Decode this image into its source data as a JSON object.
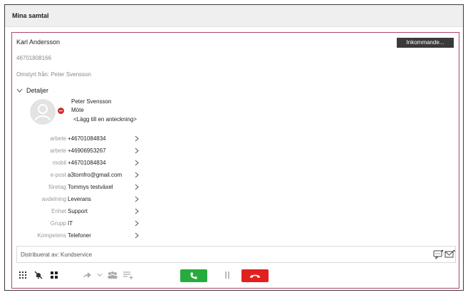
{
  "window": {
    "title": "Mina samtal"
  },
  "call": {
    "caller_name": "Karl Andersson",
    "caller_number": "46701808166",
    "redirected_from": "Omstyrt från: Peter Svensson",
    "incoming_label": "Inkommande...",
    "details_label": "Detaljer"
  },
  "contact": {
    "name": "Peter Svensson",
    "status": "Möte",
    "status_color": "#d32a2a",
    "add_note": "<Lägg till en anteckning>",
    "fields": [
      {
        "label": "arbete",
        "value": "+46701084834"
      },
      {
        "label": "arbete",
        "value": "+46906953267"
      },
      {
        "label": "mobil",
        "value": "+46701084834"
      },
      {
        "label": "e-post",
        "value": "a3tomfro@gmail.com"
      },
      {
        "label": "företag",
        "value": "Tommys testväxel"
      },
      {
        "label": "avdelning",
        "value": "Leverans"
      },
      {
        "label": "Enhet",
        "value": "Support"
      },
      {
        "label": "Grupp",
        "value": "IT"
      },
      {
        "label": "Kompetens",
        "value": "Telefoner"
      }
    ]
  },
  "distribution": {
    "text": "Distribuerat av: Kundservice"
  },
  "toolbar": {
    "answer_color": "#27ab3f",
    "hangup_color": "#e22020",
    "icons": [
      "dialpad-icon",
      "mute-icon",
      "grid-icon",
      "transfer-icon",
      "dropdown-icon",
      "conference-icon",
      "queue-icon",
      "answer-icon",
      "hold-icon",
      "hangup-icon"
    ]
  },
  "colors": {
    "panel_border": "#b0456a",
    "header_bg": "#efefef"
  }
}
